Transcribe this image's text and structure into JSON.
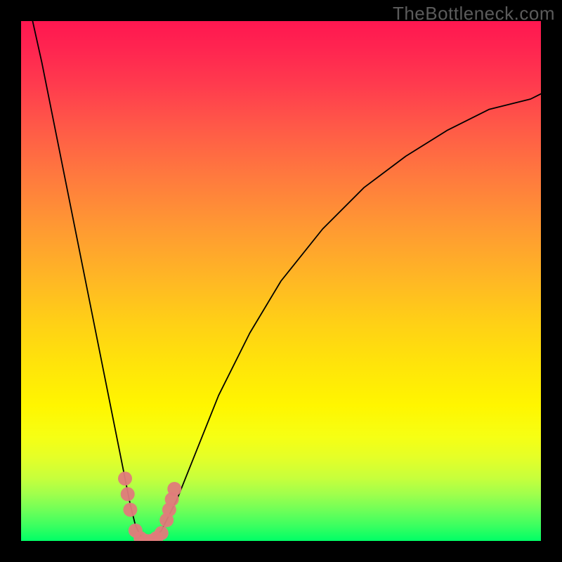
{
  "watermark": "TheBottleneck.com",
  "chart_data": {
    "type": "line",
    "title": "",
    "xlabel": "",
    "ylabel": "",
    "xlim": [
      0,
      100
    ],
    "ylim": [
      0,
      100
    ],
    "background_gradient": [
      "#ff1750",
      "#ffd900",
      "#00ff66"
    ],
    "series": [
      {
        "name": "bottleneck-curve",
        "color": "#000000",
        "stroke_width": 1.8,
        "x": [
          0,
          4,
          8,
          12,
          16,
          18,
          20,
          21,
          22,
          23,
          24,
          25,
          26,
          27,
          28,
          30,
          34,
          38,
          44,
          50,
          58,
          66,
          74,
          82,
          90,
          98,
          100
        ],
        "values": [
          110,
          92,
          72,
          52,
          32,
          22,
          12,
          7,
          3,
          1,
          0,
          0,
          1,
          2,
          4,
          8,
          18,
          28,
          40,
          50,
          60,
          68,
          74,
          79,
          83,
          85,
          86
        ]
      }
    ],
    "markers": {
      "name": "highlight-dots",
      "color": "#e07b7b",
      "points": [
        {
          "x": 20.0,
          "y": 12
        },
        {
          "x": 20.5,
          "y": 9
        },
        {
          "x": 21.0,
          "y": 6
        },
        {
          "x": 22.0,
          "y": 2
        },
        {
          "x": 23.0,
          "y": 0.5
        },
        {
          "x": 24.0,
          "y": 0
        },
        {
          "x": 25.0,
          "y": 0
        },
        {
          "x": 26.0,
          "y": 0.5
        },
        {
          "x": 27.0,
          "y": 1.5
        },
        {
          "x": 28.0,
          "y": 4
        },
        {
          "x": 28.5,
          "y": 6
        },
        {
          "x": 29.0,
          "y": 8
        },
        {
          "x": 29.5,
          "y": 10
        }
      ]
    }
  }
}
